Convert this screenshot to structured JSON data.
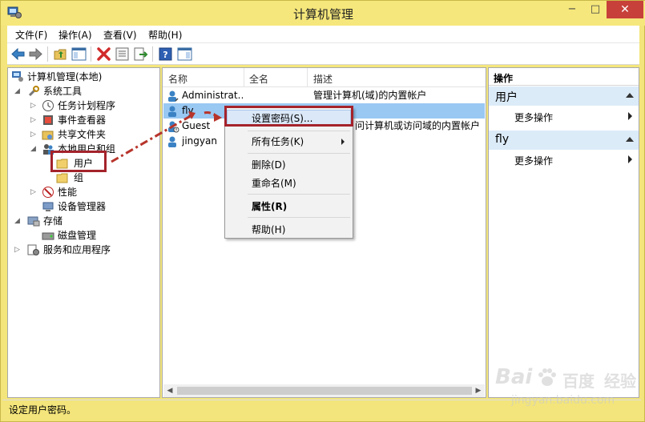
{
  "window": {
    "title": "计算机管理",
    "min": "−",
    "max": "□",
    "close": "✕"
  },
  "menubar": [
    {
      "label": "文件(F)"
    },
    {
      "label": "操作(A)"
    },
    {
      "label": "查看(V)"
    },
    {
      "label": "帮助(H)"
    }
  ],
  "toolbar_icons": [
    "back-arrow-icon",
    "forward-arrow-icon",
    "up-folder-icon",
    "show-hide-tree-icon",
    "delete-icon",
    "properties-icon",
    "export-list-icon",
    "help-icon",
    "action-pane-icon"
  ],
  "tree": [
    {
      "label": "计算机管理(本地)",
      "icon": "computer-management-icon",
      "expander": ""
    },
    {
      "label": "系统工具",
      "icon": "system-tools-icon",
      "expander": "◢"
    },
    {
      "label": "任务计划程序",
      "icon": "task-scheduler-icon",
      "expander": "▷"
    },
    {
      "label": "事件查看器",
      "icon": "event-viewer-icon",
      "expander": "▷"
    },
    {
      "label": "共享文件夹",
      "icon": "shared-folders-icon",
      "expander": "▷"
    },
    {
      "label": "本地用户和组",
      "icon": "local-users-icon",
      "expander": "◢"
    },
    {
      "label": "用户",
      "icon": "folder-icon",
      "expander": ""
    },
    {
      "label": "组",
      "icon": "folder-icon",
      "expander": ""
    },
    {
      "label": "性能",
      "icon": "performance-icon",
      "expander": "▷"
    },
    {
      "label": "设备管理器",
      "icon": "device-manager-icon",
      "expander": ""
    },
    {
      "label": "存储",
      "icon": "storage-icon",
      "expander": "◢"
    },
    {
      "label": "磁盘管理",
      "icon": "disk-management-icon",
      "expander": ""
    },
    {
      "label": "服务和应用程序",
      "icon": "services-apps-icon",
      "expander": "▷"
    }
  ],
  "list": {
    "columns": [
      "名称",
      "全名",
      "描述"
    ],
    "rows": [
      {
        "name": "Administrat…",
        "fullname": "",
        "desc": "管理计算机(域)的内置帐户"
      },
      {
        "name": "fly",
        "fullname": "",
        "desc": ""
      },
      {
        "name": "Guest",
        "fullname": "",
        "desc": "问计算机或访问域的内置帐户"
      },
      {
        "name": "jingyan",
        "fullname": "",
        "desc": ""
      }
    ]
  },
  "context_menu": [
    {
      "label": "设置密码(S)...",
      "bold": false,
      "submenu": false
    },
    {
      "label": "所有任务(K)",
      "bold": false,
      "submenu": true
    },
    {
      "label": "删除(D)",
      "bold": false,
      "submenu": false
    },
    {
      "label": "重命名(M)",
      "bold": false,
      "submenu": false
    },
    {
      "label": "属性(R)",
      "bold": true,
      "submenu": false
    },
    {
      "label": "帮助(H)",
      "bold": false,
      "submenu": false
    }
  ],
  "actions": {
    "title": "操作",
    "groups": [
      {
        "label": "用户",
        "item": "更多操作"
      },
      {
        "label": "fly",
        "item": "更多操作"
      }
    ]
  },
  "status": {
    "text": "设定用户密码。"
  },
  "watermark": {
    "logo": "Bai",
    "logo2": "百度",
    "url": "jingyan.baidu.com",
    "sub": "经验"
  },
  "colors": {
    "titlebar": "#f5e77b",
    "selection": "#99c8f3",
    "highlight_box": "#a4232b",
    "close": "#c7413a"
  }
}
